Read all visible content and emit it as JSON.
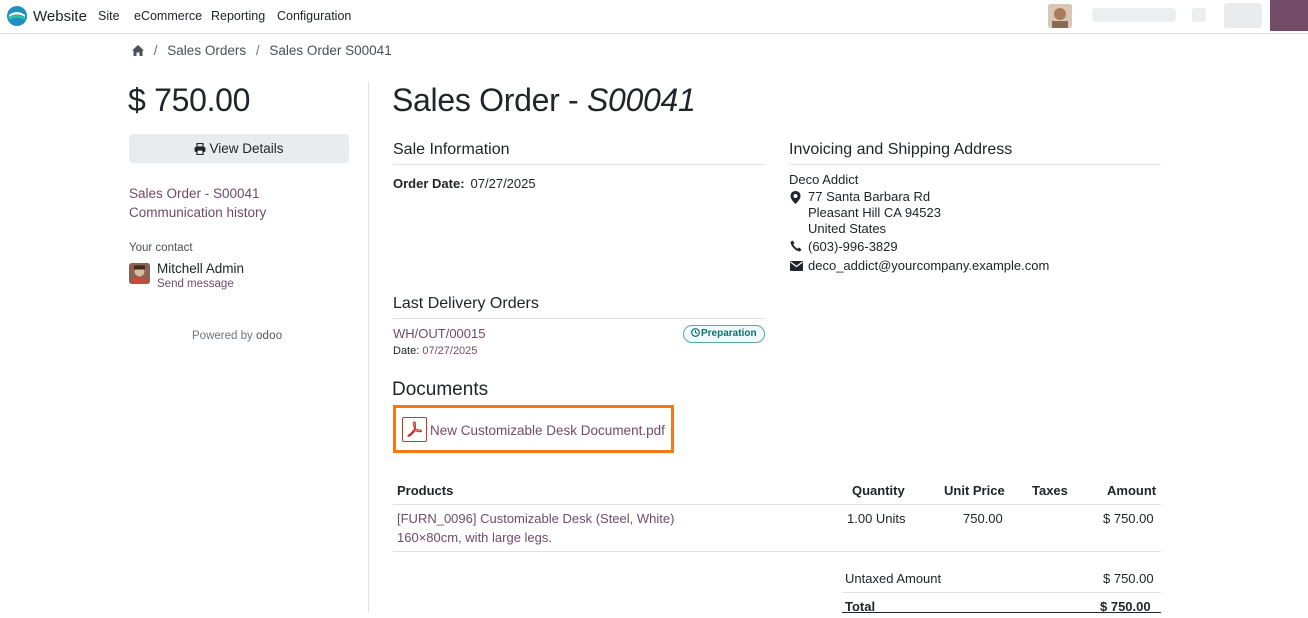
{
  "topbar": {
    "app_name": "Website",
    "menu": [
      "Site",
      "eCommerce",
      "Reporting",
      "Configuration"
    ]
  },
  "breadcrumb": [
    "Sales Orders",
    "Sales Order S00041"
  ],
  "sidebar": {
    "amount": "$ 750.00",
    "view_details": "View Details",
    "links": [
      "Sales Order - S00041",
      "Communication history"
    ],
    "contact_label": "Your contact",
    "contact_name": "Mitchell Admin",
    "send_message": "Send message",
    "powered_by": "Powered by",
    "powered_brand": "odoo"
  },
  "order": {
    "title_prefix": "Sales Order - ",
    "title_number": "S00041",
    "sale_info_heading": "Sale Information",
    "order_date_label": "Order Date:",
    "order_date": "07/27/2025",
    "address_heading": "Invoicing and Shipping Address",
    "address": {
      "name": "Deco Addict",
      "street": "77 Santa Barbara Rd",
      "city": "Pleasant Hill CA 94523",
      "country": "United States",
      "phone": "(603)-996-3829",
      "email": "deco_addict@yourcompany.example.com"
    },
    "delivery_heading": "Last Delivery Orders",
    "delivery_ref": "WH/OUT/00015",
    "delivery_date_label": "Date:",
    "delivery_date": "07/27/2025",
    "delivery_status": "Preparation",
    "documents_heading": "Documents",
    "document_name": "New Customizable Desk Document.pdf"
  },
  "table": {
    "headers": [
      "Products",
      "Quantity",
      "Unit Price",
      "Taxes",
      "Amount"
    ],
    "rows": [
      {
        "product": "[FURN_0096] Customizable Desk (Steel, White)",
        "description": "160×80cm, with large legs.",
        "quantity": "1.00 Units",
        "unit_price": "750.00",
        "taxes": "",
        "amount": "$ 750.00"
      }
    ],
    "untaxed_label": "Untaxed Amount",
    "untaxed_value": "$ 750.00",
    "total_label": "Total",
    "total_value": "$ 750.00"
  },
  "colors": {
    "brand": "#714b67",
    "highlight_border": "#f07a1a",
    "badge": "#0f6e6e"
  }
}
